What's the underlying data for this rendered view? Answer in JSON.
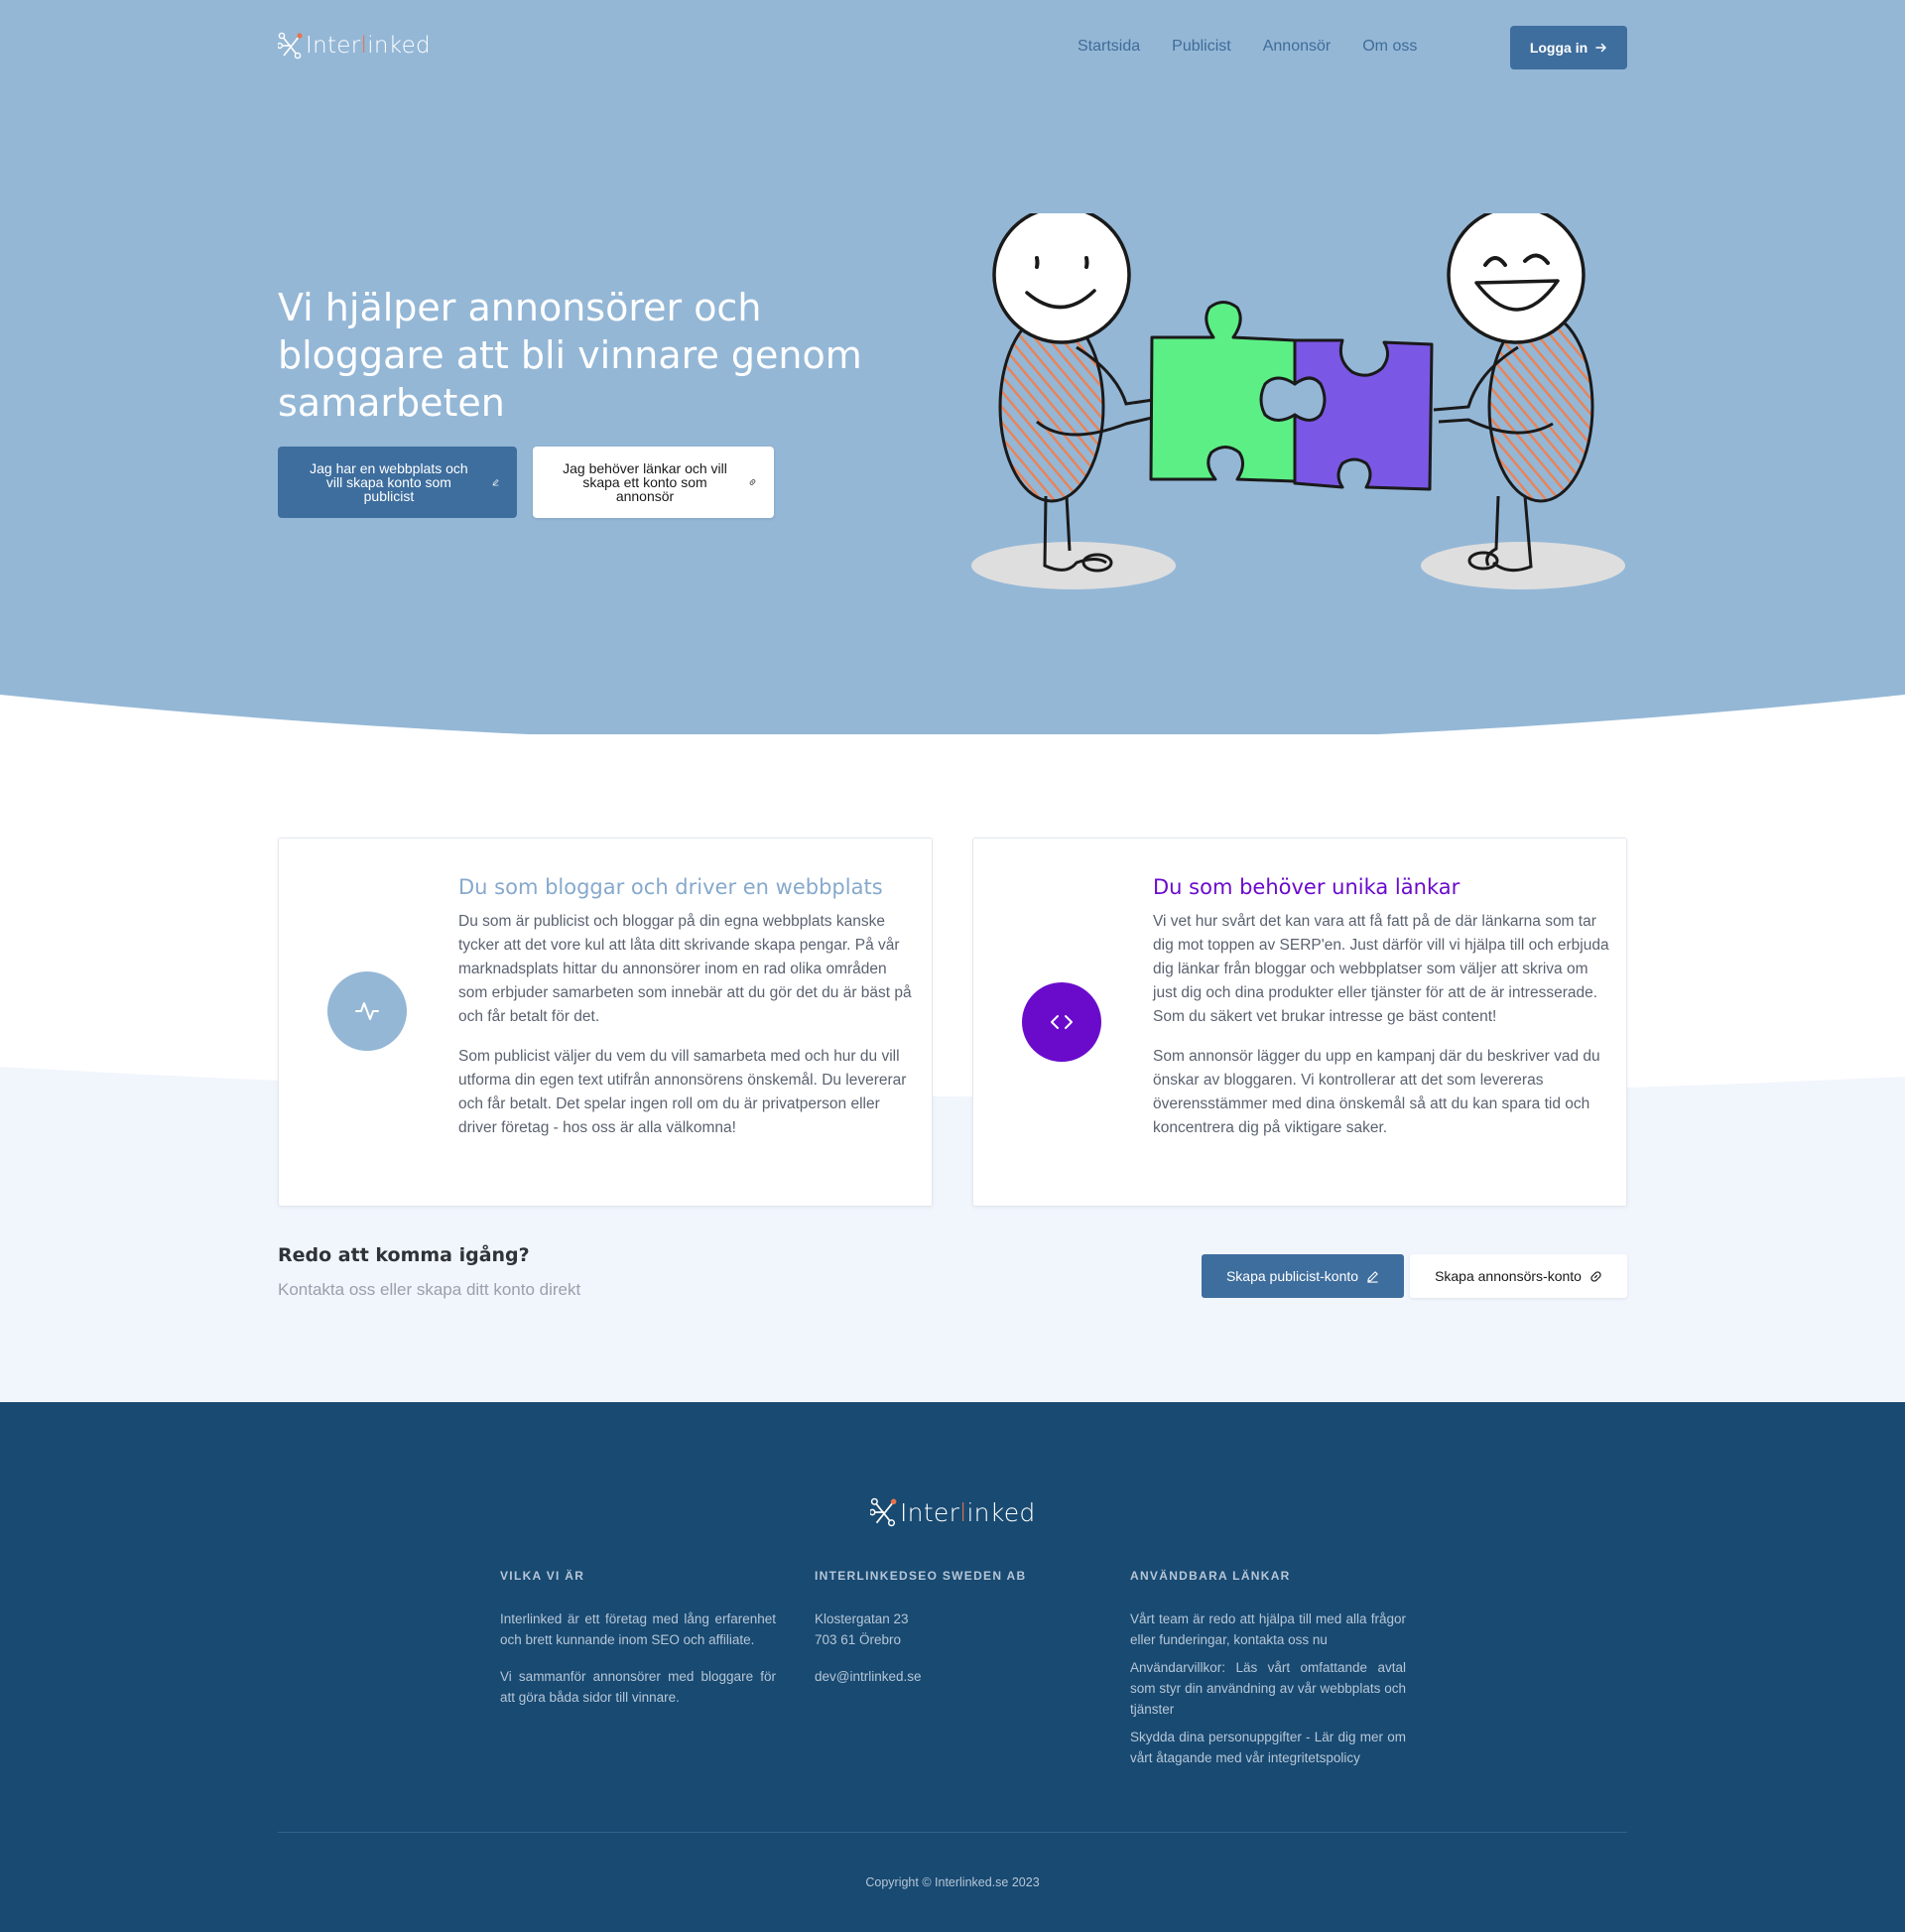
{
  "brand": {
    "logo_text_pre": "Inter",
    "logo_text_mid": "l",
    "logo_text_post": "inked"
  },
  "nav": {
    "links": [
      "Startsida",
      "Publicist",
      "Annonsör",
      "Om oss"
    ],
    "login_label": "Logga in"
  },
  "hero": {
    "title": "Vi hjälper annonsörer och bloggare att bli vinnare genom samarbeten",
    "publisher_button": "Jag har en webbplats och vill skapa konto som publicist",
    "advertiser_button": "Jag behöver länkar och vill skapa ett konto som annonsör"
  },
  "cards": [
    {
      "icon": "activity-icon",
      "title": "Du som bloggar och driver en webbplats",
      "paragraphs": [
        "Du som är publicist och bloggar på din egna webbplats kanske tycker att det vore kul att låta ditt skrivande skapa pengar. På vår marknadsplats hittar du annonsörer inom en rad olika områden som erbjuder samarbeten som innebär att du gör det du är bäst på och får betalt för det.",
        "Som publicist väljer du vem du vill samarbeta med och hur du vill utforma din egen text utifrån annonsörens önskemål. Du levererar och får betalt. Det spelar ingen roll om du är privatperson eller driver företag - hos oss är alla välkomna!"
      ]
    },
    {
      "icon": "code-icon",
      "title": "Du som behöver unika länkar",
      "paragraphs": [
        "Vi vet hur svårt det kan vara att få fatt på de där länkarna som tar dig mot toppen av SERP'en. Just därför vill vi hjälpa till och erbjuda dig länkar från bloggar och webbplatser som väljer att skriva om just dig och dina produkter eller tjänster för att de är intresserade. Som du säkert vet brukar intresse ge bäst content!",
        "Som annonsör lägger du upp en kampanj där du beskriver vad du önskar av bloggaren. Vi kontrollerar att det som levereras överensstämmer med dina önskemål så att du kan spara tid och koncentrera dig på viktigare saker."
      ]
    }
  ],
  "cta": {
    "title": "Redo att komma igång?",
    "subtitle": "Kontakta oss eller skapa ditt konto direkt",
    "publisher_button": "Skapa publicist-konto",
    "advertiser_button": "Skapa annonsörs-konto"
  },
  "footer": {
    "columns": [
      {
        "heading": "Vilka vi är",
        "texts": [
          "Interlinked är ett företag med lång erfarenhet och brett kunnande inom SEO och affiliate.",
          "Vi sammanför annonsörer med bloggare för att göra båda sidor till vinnare."
        ]
      },
      {
        "heading": "InterlinkedSEO Sweden AB",
        "address_line_1": "Klostergatan 23",
        "address_line_2": "703 61 Örebro",
        "email": "dev@intrlinked.se"
      },
      {
        "heading": "Användbara länkar",
        "links": [
          "Vårt team är redo att hjälpa till med alla frågor eller funderingar, kontakta oss nu",
          "Användarvillkor: Läs vårt omfattande avtal som styr din användning av vår webbplats och tjänster",
          "Skydda dina personuppgifter - Lär dig mer om vårt åtagande med vår integritetspolicy"
        ]
      }
    ],
    "copyright": "Copyright © Interlinked.se 2023"
  },
  "colors": {
    "hero_bg": "#94b7d6",
    "primary": "#3e6e9e",
    "accent_purple": "#6a0bcc",
    "footer_bg": "#184a72",
    "logo_accent": "#e8734a"
  }
}
